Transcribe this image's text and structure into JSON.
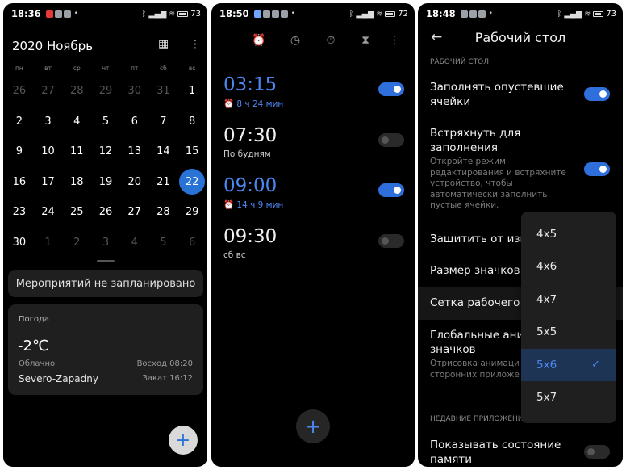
{
  "colors": {
    "accent": "#4d86f0",
    "toggle_on": "#2f6fdc",
    "today": "#2a73d6",
    "card": "#1f1f1f"
  },
  "calendar": {
    "status": {
      "time": "18:36",
      "battery": "73"
    },
    "title": "2020 Ноябрь",
    "weekdays": [
      "пн",
      "вт",
      "ср",
      "чт",
      "пт",
      "сб",
      "вс"
    ],
    "weeks": [
      [
        "26",
        "27",
        "28",
        "29",
        "30",
        "31",
        "1"
      ],
      [
        "2",
        "3",
        "4",
        "5",
        "6",
        "7",
        "8"
      ],
      [
        "9",
        "10",
        "11",
        "12",
        "13",
        "14",
        "15"
      ],
      [
        "16",
        "17",
        "18",
        "19",
        "20",
        "21",
        "22"
      ],
      [
        "23",
        "24",
        "25",
        "26",
        "27",
        "28",
        "29"
      ],
      [
        "30",
        "1",
        "2",
        "3",
        "4",
        "5",
        "6"
      ]
    ],
    "today": "22",
    "no_events": "Мероприятий не запланировано",
    "weather": {
      "title": "Погода",
      "temp": "-2℃",
      "condition": "Облачно",
      "sunrise": "Восход 08:20",
      "city": "Severo-Zapadny",
      "sunset": "Закат 16:12"
    },
    "fab": "+"
  },
  "alarms": {
    "status": {
      "time": "18:50",
      "battery": "72"
    },
    "tab_icons": [
      "alarm-icon",
      "clock-icon",
      "stopwatch-icon",
      "timer-icon"
    ],
    "items": [
      {
        "time": "03:15",
        "sub": "⏰ 8 ч 24 мин",
        "on": true
      },
      {
        "time": "07:30",
        "sub": "По будням",
        "on": false
      },
      {
        "time": "09:00",
        "sub": "⏰ 14 ч 9 мин",
        "on": true
      },
      {
        "time": "09:30",
        "sub": "сб вс",
        "on": false
      }
    ],
    "fab": "+"
  },
  "settings": {
    "status": {
      "time": "18:48",
      "battery": "73"
    },
    "title": "Рабочий стол",
    "section_desktop": "РАБОЧИЙ СТОЛ",
    "fill_empty": "Заполнять опустевшие ячейки",
    "shake_fill": "Встряхнуть для заполнения",
    "shake_desc": "Откройте режим редактирования и встряхните устройство, чтобы автоматически заполнить пустые ячейки.",
    "protect": "Защитить от изм",
    "icon_size": "Размер значков",
    "grid": "Сетка рабочего",
    "global_anim": "Глобальные ани значков",
    "anim_desc": "Отрисовка анимаци сторонних приложе",
    "section_recent": "НЕДАВНИЕ ПРИЛОЖЕНИЯ",
    "show_memory": "Показывать состояние памяти",
    "grid_options": [
      "4x5",
      "4x6",
      "4x7",
      "5x5",
      "5x6",
      "5x7"
    ],
    "grid_selected": "5x6"
  }
}
